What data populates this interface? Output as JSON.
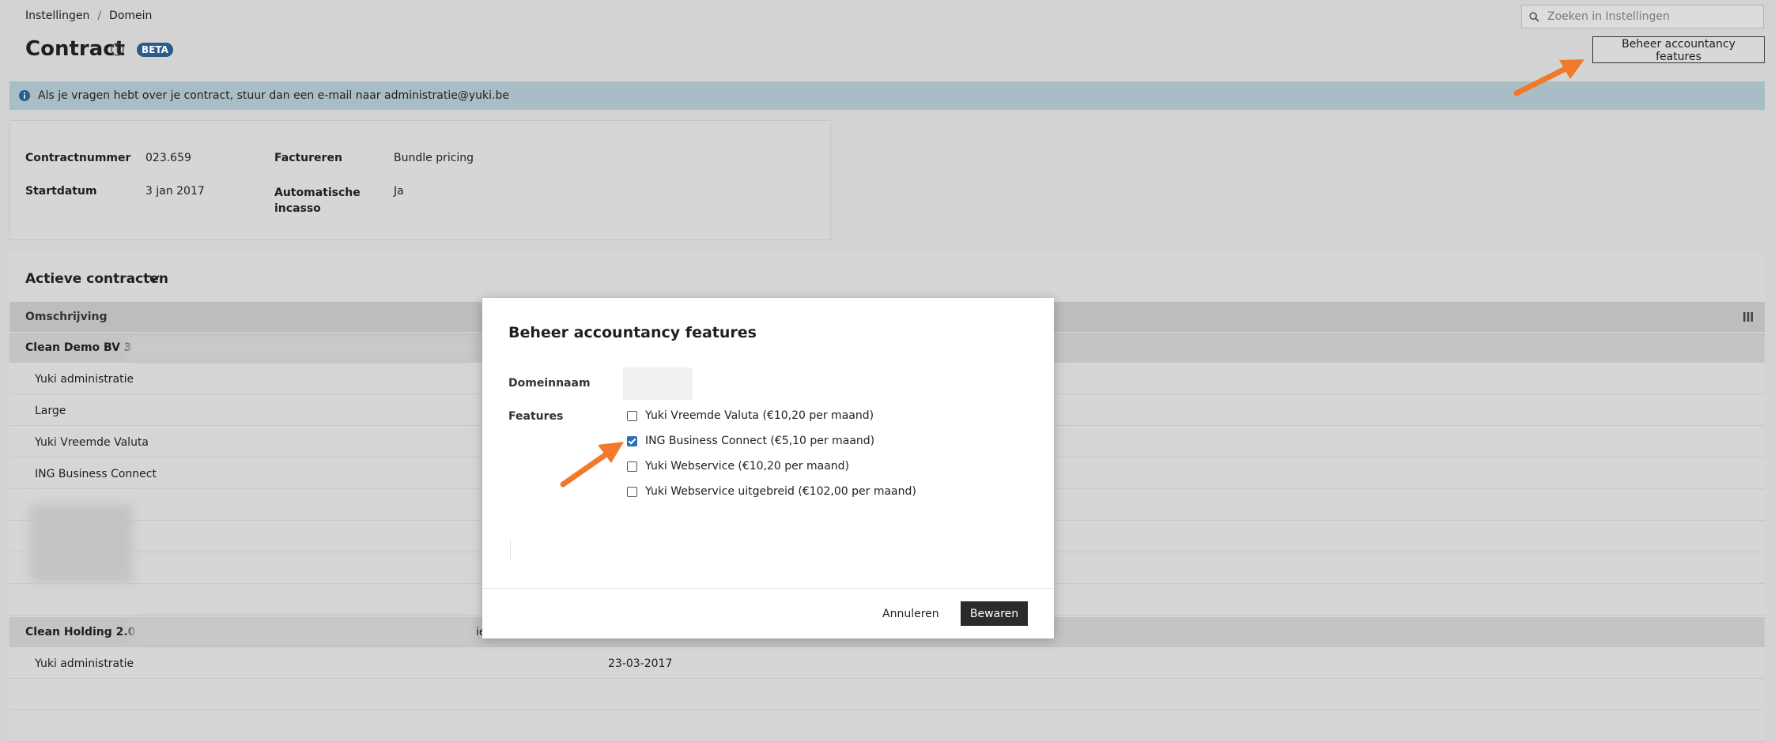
{
  "breadcrumb": {
    "items": [
      "Instellingen",
      "Domein"
    ],
    "separator": "/"
  },
  "search": {
    "placeholder": "Zoeken in Instellingen"
  },
  "page": {
    "title": "Contract",
    "badge": "BETA",
    "top_button": "Beheer accountancy features"
  },
  "banner": {
    "text": "Als je vragen hebt over je contract, stuur dan een e-mail naar administratie@yuki.be"
  },
  "contract": {
    "number_label": "Contractnummer",
    "number_value": "023.659",
    "billing_label": "Factureren",
    "billing_value": "Bundle pricing",
    "start_label": "Startdatum",
    "start_value": "3 jan 2017",
    "auto_label_1": "Automatische",
    "auto_label_2": "incasso",
    "auto_value": "Ja"
  },
  "active": {
    "title": "Actieve contracten",
    "column_header": "Omschrijving",
    "group1": {
      "name": "Clean Demo BV 3 -",
      "items": [
        "Yuki administratie",
        "Large",
        "Yuki Vreemde Valuta",
        "ING Business Connect"
      ]
    },
    "group2": {
      "name": "Clean Holding 2.0 -",
      "trail": "ie",
      "items": [
        {
          "name": "Yuki administratie",
          "date": "23-03-2017"
        }
      ]
    }
  },
  "modal": {
    "title": "Beheer accountancy features",
    "domain_label": "Domeinnaam",
    "features_label": "Features",
    "features": [
      {
        "label": "Yuki Vreemde Valuta (€10,20 per maand)",
        "checked": false
      },
      {
        "label": "ING Business Connect (€5,10 per maand)",
        "checked": true
      },
      {
        "label": "Yuki Webservice (€10,20 per maand)",
        "checked": false
      },
      {
        "label": "Yuki Webservice uitgebreid (€102,00 per maand)",
        "checked": false
      }
    ],
    "cancel": "Annuleren",
    "save": "Bewaren"
  },
  "colors": {
    "accent": "#2c6fb7",
    "arrow": "#f07a2a",
    "badge": "#2a5c8a"
  }
}
